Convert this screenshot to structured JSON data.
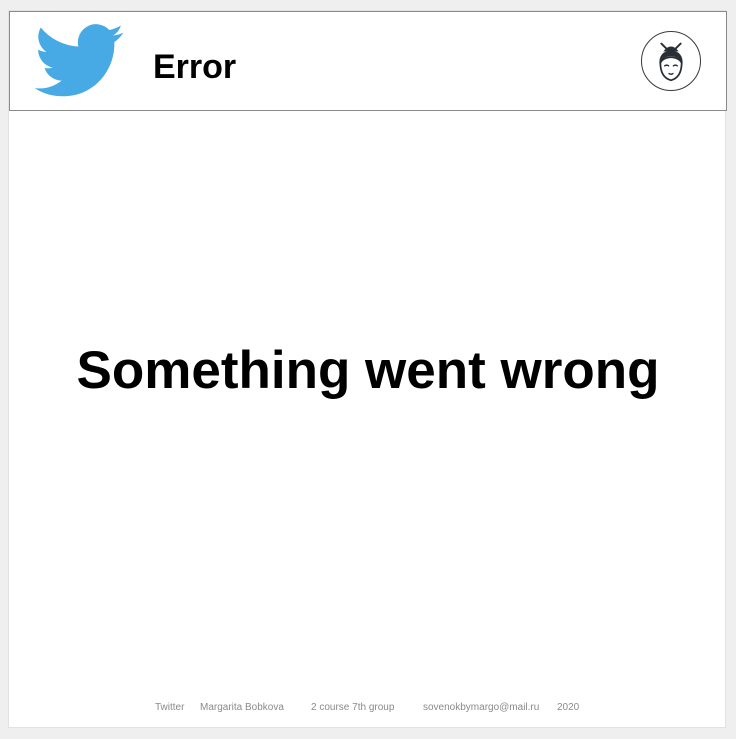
{
  "header": {
    "logo_icon": "twitter-bird-icon",
    "title": "Error",
    "avatar_icon": "geisha-face-icon"
  },
  "main": {
    "message": "Something went wrong"
  },
  "footer": {
    "items": [
      "Twitter",
      "Margarita Bobkova",
      "2 course 7th group",
      "sovenokbymargo@mail.ru",
      "2020"
    ]
  },
  "colors": {
    "brand": "#47aae5",
    "page_background": "#efefef",
    "card_background": "#ffffff",
    "header_border": "#8a8a8a",
    "footer_text": "#8a8a8a"
  }
}
